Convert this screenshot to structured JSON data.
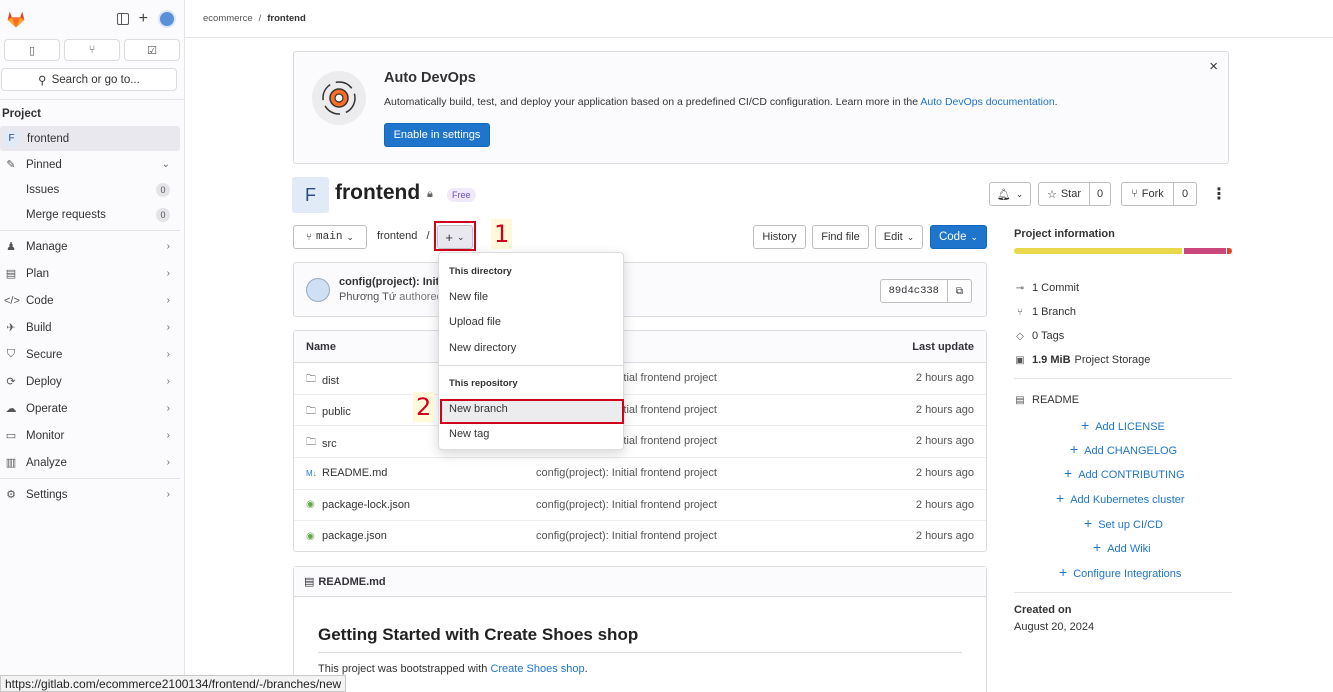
{
  "sidebar": {
    "search_label": "Search or go to...",
    "section_label": "Project",
    "project_letter": "F",
    "project_name": "frontend",
    "pinned_label": "Pinned",
    "issues_label": "Issues",
    "issues_count": "0",
    "merge_label": "Merge requests",
    "merge_count": "0",
    "menu": [
      "Manage",
      "Plan",
      "Code",
      "Build",
      "Secure",
      "Deploy",
      "Operate",
      "Monitor",
      "Analyze"
    ],
    "settings_label": "Settings"
  },
  "breadcrumb": {
    "group": "ecommerce",
    "sep": "/",
    "project": "frontend"
  },
  "banner": {
    "title": "Auto DevOps",
    "text": "Automatically build, test, and deploy your application based on a predefined CI/CD configuration. Learn more in the",
    "link": "Auto DevOps documentation",
    "link_suffix": ".",
    "button": "Enable in settings",
    "close": "×"
  },
  "project": {
    "avatar_letter": "F",
    "name": "frontend",
    "badge": "Free",
    "star_label": "Star",
    "star_count": "0",
    "fork_label": "Fork",
    "fork_count": "0"
  },
  "toolbar": {
    "branch": "main",
    "path": "frontend",
    "path_sep": "/",
    "history": "History",
    "find_file": "Find file",
    "edit": "Edit",
    "code": "Code"
  },
  "annotations": {
    "step1": "1",
    "step2": "2"
  },
  "dropdown": {
    "dir_heading": "This directory",
    "new_file": "New file",
    "upload_file": "Upload file",
    "new_directory": "New directory",
    "repo_heading": "This repository",
    "new_branch": "New branch",
    "new_tag": "New tag"
  },
  "commit": {
    "message": "config(project): Initi",
    "author": "Phương Tứ",
    "authored": "authored",
    "sha": "89d4c338"
  },
  "files": {
    "col_name": "Name",
    "col_update": "Last update",
    "rows": [
      {
        "name": "dist",
        "icon": "folder",
        "commit": "config(project): Initial frontend project",
        "time": "2 hours ago"
      },
      {
        "name": "public",
        "icon": "folder",
        "commit": "config(project): Initial frontend project",
        "time": "2 hours ago"
      },
      {
        "name": "src",
        "icon": "folder",
        "commit": "config(project): Initial frontend project",
        "time": "2 hours ago"
      },
      {
        "name": "README.md",
        "icon": "markdown",
        "commit": "config(project): Initial frontend project",
        "time": "2 hours ago"
      },
      {
        "name": "package-lock.json",
        "icon": "json",
        "commit": "config(project): Initial frontend project",
        "time": "2 hours ago"
      },
      {
        "name": "package.json",
        "icon": "json",
        "commit": "config(project): Initial frontend project",
        "time": "2 hours ago"
      }
    ]
  },
  "readme": {
    "filename": "README.md",
    "heading": "Getting Started with Create Shoes shop",
    "text": "This project was bootstrapped with",
    "link": "Create Shoes shop",
    "link_suffix": "."
  },
  "info": {
    "heading": "Project information",
    "commits": "1 Commit",
    "branches": "1 Branch",
    "tags": "0 Tags",
    "storage_size": "1.9 MiB",
    "storage_label": "Project Storage",
    "readme": "README",
    "links": [
      "Add LICENSE",
      "Add CHANGELOG",
      "Add CONTRIBUTING",
      "Add Kubernetes cluster",
      "Set up CI/CD",
      "Add Wiki",
      "Configure Integrations"
    ],
    "created_label": "Created on",
    "created_date": "August 20, 2024",
    "lang_colors": [
      "#e9d94a",
      "#c9477d",
      "#e24329"
    ]
  },
  "status_url": "https://gitlab.com/ecommerce2100134/frontend/-/branches/new",
  "colors": {
    "accent": "#1f75cb",
    "highlight": "#d0021b"
  }
}
